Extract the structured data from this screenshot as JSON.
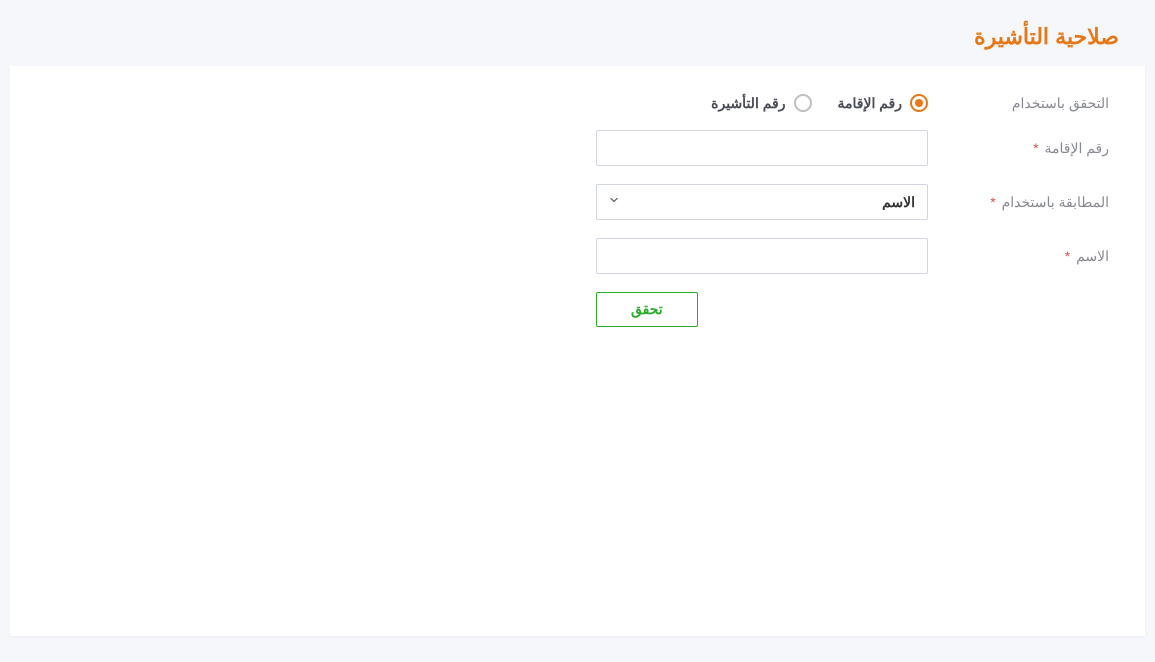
{
  "page": {
    "title": "صلاحية التأشيرة"
  },
  "form": {
    "verify_by_label": "التحقق باستخدام",
    "radio_options": {
      "residence": "رقم الإقامة",
      "visa": "رقم التأشيرة"
    },
    "residence_number_label": "رقم الإقامة",
    "match_by_label": "المطابقة باستخدام",
    "match_by_selected": "الاسم",
    "name_label": "الاسم",
    "required_mark": "*",
    "verify_button": "تحقق"
  }
}
